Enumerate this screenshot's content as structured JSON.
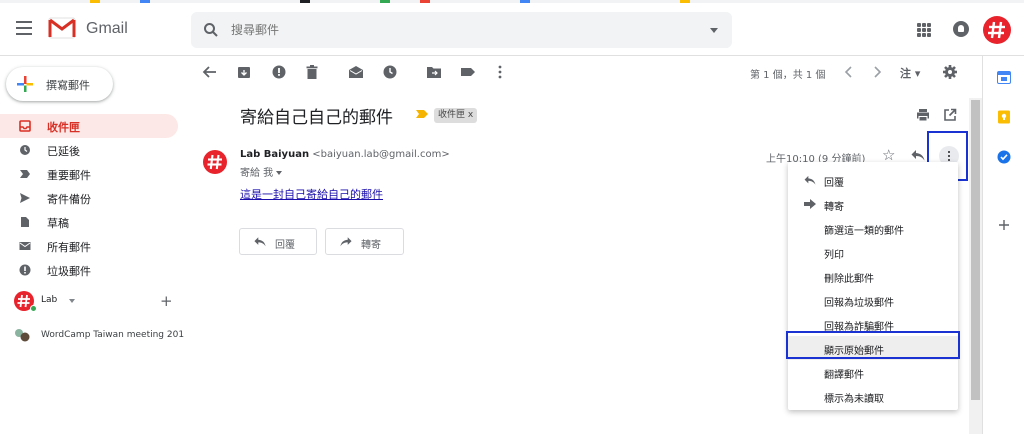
{
  "app": {
    "name": "Gmail"
  },
  "colors": {
    "accent_red": "#d93025",
    "brand_red": "#e8232c",
    "highlight_box": "#1a32d1",
    "link": "#1a0dab"
  },
  "search": {
    "placeholder": "搜尋郵件"
  },
  "compose": {
    "label": "撰寫郵件"
  },
  "nav": [
    {
      "label": "收件匣",
      "icon": "inbox-icon",
      "active": true
    },
    {
      "label": "已延後",
      "icon": "clock-icon"
    },
    {
      "label": "重要郵件",
      "icon": "important-icon"
    },
    {
      "label": "寄件備份",
      "icon": "send-icon"
    },
    {
      "label": "草稿",
      "icon": "draft-icon"
    },
    {
      "label": "所有郵件",
      "icon": "mail-icon"
    },
    {
      "label": "垃圾郵件",
      "icon": "spam-icon"
    }
  ],
  "hangouts": {
    "user": "Lab",
    "add": "+",
    "conversation": "WordCamp Taiwan meeting 201"
  },
  "toolbar": {
    "pager": "第 1 個，共 1 個",
    "lang": "注"
  },
  "message": {
    "subject": "寄給自己自己的郵件",
    "label_chip": "收件匣 x",
    "sender_name": "Lab Baiyuan",
    "sender_email": "<baiyuan.lab@gmail.com>",
    "to": "寄給 我",
    "time": "上午10:10 (9 分鐘前)",
    "body": "這是一封自己寄給自己的郵件",
    "reply_label": "回覆",
    "forward_label": "轉寄"
  },
  "menu": [
    {
      "label": "回覆",
      "icon": "reply-icon"
    },
    {
      "label": "轉寄",
      "icon": "forward-icon"
    },
    {
      "label": "篩選這一類的郵件"
    },
    {
      "label": "列印"
    },
    {
      "label": "刪除此郵件"
    },
    {
      "label": "回報為垃圾郵件"
    },
    {
      "label": "回報為詐騙郵件"
    },
    {
      "label": "顯示原始郵件",
      "highlighted": true
    },
    {
      "label": "翻譯郵件"
    },
    {
      "label": "標示為未讀取"
    }
  ]
}
